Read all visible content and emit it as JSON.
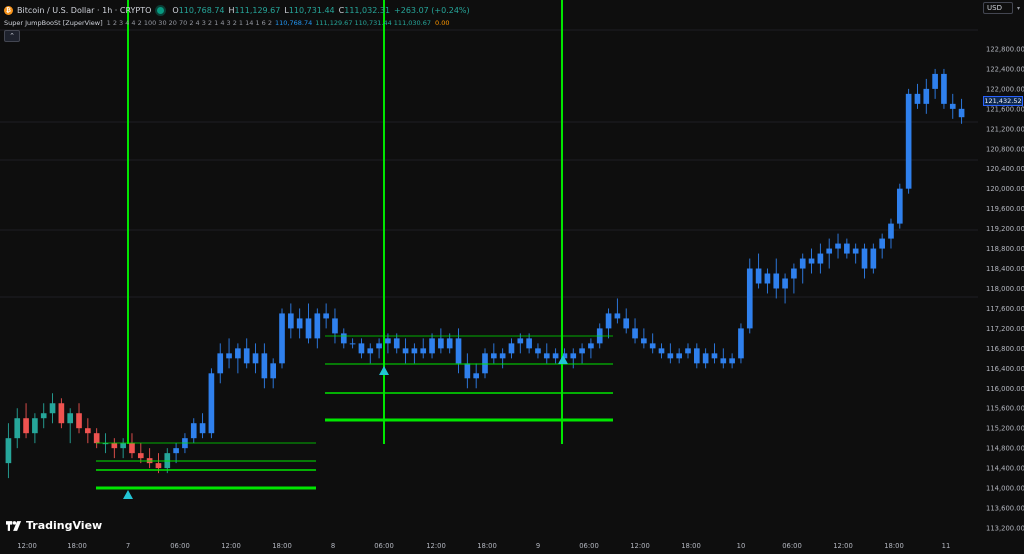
{
  "header": {
    "symbol": "Bitcoin / U.S. Dollar · 1h · CRYPTO",
    "coin_glyph": "₿",
    "ohlc": [
      {
        "label": "O",
        "value": "110,768.74"
      },
      {
        "label": "H",
        "value": "111,129.67"
      },
      {
        "label": "L",
        "value": "110,731.44"
      },
      {
        "label": "C",
        "value": "111,032.31"
      },
      {
        "label": "",
        "value": "+263.07 (+0.24%)"
      }
    ]
  },
  "indicator": {
    "name": "Super JumpBooSt [ZuperView]",
    "params": "1 2 3 4 4 2 100 30 20 70 2 4 3 2 1 4 3 2 1 14 1 6 2",
    "v1": "110,768.74",
    "v2": "111,129.67 110,731.44 111,030.67",
    "v3": "0.00"
  },
  "currency": "USD",
  "current_price": "121,432.52",
  "branding": "TradingView",
  "icons": {
    "collapse": "chevron-up-icon",
    "logo": "tradingview-logo-icon",
    "currency_dropdown": "chevron-down-icon"
  },
  "colors": {
    "background": "#0e0e0e",
    "bull_early": "#26a69a",
    "bear_early": "#ef5350",
    "candle": "#2f80ed",
    "signal": "#00e600",
    "marker": "#22c4d4"
  },
  "chart_data": {
    "type": "candlestick",
    "ylim": [
      113200,
      123200
    ],
    "y_ticks": [
      "122,800.00",
      "122,400.00",
      "122,000.00",
      "121,600.00",
      "121,200.00",
      "120,800.00",
      "120,400.00",
      "120,000.00",
      "119,600.00",
      "119,200.00",
      "118,800.00",
      "118,400.00",
      "118,000.00",
      "117,600.00",
      "117,200.00",
      "116,800.00",
      "116,400.00",
      "116,000.00",
      "115,600.00",
      "115,200.00",
      "114,800.00",
      "114,400.00",
      "114,000.00",
      "113,600.00",
      "113,200.00"
    ],
    "x_ticks": [
      "12:00",
      "18:00",
      "7",
      "06:00",
      "12:00",
      "18:00",
      "8",
      "06:00",
      "12:00",
      "18:00",
      "9",
      "06:00",
      "12:00",
      "18:00",
      "10",
      "06:00",
      "12:00",
      "18:00",
      "11"
    ],
    "candles": [
      [
        114500,
        115300,
        114200,
        115000
      ],
      [
        115000,
        115600,
        114800,
        115400
      ],
      [
        115400,
        115700,
        115000,
        115100
      ],
      [
        115100,
        115500,
        114900,
        115400
      ],
      [
        115400,
        115700,
        115200,
        115500
      ],
      [
        115500,
        115900,
        115300,
        115700
      ],
      [
        115700,
        115800,
        115200,
        115300
      ],
      [
        115300,
        115600,
        114900,
        115500
      ],
      [
        115500,
        115700,
        115100,
        115200
      ],
      [
        115200,
        115400,
        114900,
        115100
      ],
      [
        115100,
        115200,
        114800,
        114900
      ],
      [
        114900,
        115100,
        114700,
        114900
      ],
      [
        114900,
        115000,
        114600,
        114800
      ],
      [
        114800,
        115000,
        114600,
        114900
      ],
      [
        114900,
        115100,
        114600,
        114700
      ],
      [
        114700,
        114900,
        114500,
        114600
      ],
      [
        114600,
        114800,
        114400,
        114500
      ],
      [
        114500,
        114700,
        114300,
        114400
      ],
      [
        114400,
        114800,
        114300,
        114700
      ],
      [
        114700,
        114900,
        114500,
        114800
      ],
      [
        114800,
        115100,
        114700,
        115000
      ],
      [
        115000,
        115400,
        114900,
        115300
      ],
      [
        115300,
        115500,
        115000,
        115100
      ],
      [
        115100,
        116400,
        115000,
        116300
      ],
      [
        116300,
        116900,
        116100,
        116700
      ],
      [
        116700,
        117000,
        116400,
        116600
      ],
      [
        116600,
        116900,
        116300,
        116800
      ],
      [
        116800,
        117000,
        116400,
        116500
      ],
      [
        116500,
        116900,
        116300,
        116700
      ],
      [
        116700,
        116900,
        116000,
        116200
      ],
      [
        116200,
        116600,
        116000,
        116500
      ],
      [
        116500,
        117600,
        116400,
        117500
      ],
      [
        117500,
        117700,
        117000,
        117200
      ],
      [
        117200,
        117600,
        117000,
        117400
      ],
      [
        117400,
        117700,
        116900,
        117000
      ],
      [
        117000,
        117600,
        116800,
        117500
      ],
      [
        117500,
        117700,
        117200,
        117400
      ],
      [
        117400,
        117600,
        116900,
        117100
      ],
      [
        117100,
        117200,
        116800,
        116900
      ],
      [
        116900,
        117000,
        116800,
        116900
      ],
      [
        116900,
        117000,
        116600,
        116700
      ],
      [
        116700,
        116900,
        116500,
        116800
      ],
      [
        116800,
        117000,
        116600,
        116900
      ],
      [
        116900,
        117100,
        116700,
        117000
      ],
      [
        117000,
        117100,
        116700,
        116800
      ],
      [
        116800,
        117000,
        116500,
        116700
      ],
      [
        116700,
        116900,
        116500,
        116800
      ],
      [
        116800,
        117000,
        116600,
        116700
      ],
      [
        116700,
        117100,
        116600,
        117000
      ],
      [
        117000,
        117200,
        116700,
        116800
      ],
      [
        116800,
        117100,
        116700,
        117000
      ],
      [
        117000,
        117200,
        116300,
        116500
      ],
      [
        116500,
        116700,
        116000,
        116200
      ],
      [
        116200,
        116500,
        116000,
        116300
      ],
      [
        116300,
        116800,
        116200,
        116700
      ],
      [
        116700,
        116900,
        116500,
        116600
      ],
      [
        116600,
        116800,
        116400,
        116700
      ],
      [
        116700,
        117000,
        116600,
        116900
      ],
      [
        116900,
        117100,
        116700,
        117000
      ],
      [
        117000,
        117100,
        116700,
        116800
      ],
      [
        116800,
        116900,
        116600,
        116700
      ],
      [
        116700,
        116900,
        116500,
        116600
      ],
      [
        116600,
        116800,
        116500,
        116700
      ],
      [
        116700,
        116800,
        116500,
        116600
      ],
      [
        116600,
        116800,
        116400,
        116700
      ],
      [
        116700,
        116900,
        116500,
        116800
      ],
      [
        116800,
        117000,
        116600,
        116900
      ],
      [
        116900,
        117300,
        116800,
        117200
      ],
      [
        117200,
        117600,
        117000,
        117500
      ],
      [
        117500,
        117800,
        117300,
        117400
      ],
      [
        117400,
        117600,
        117100,
        117200
      ],
      [
        117200,
        117400,
        116900,
        117000
      ],
      [
        117000,
        117200,
        116800,
        116900
      ],
      [
        116900,
        117100,
        116700,
        116800
      ],
      [
        116800,
        116900,
        116600,
        116700
      ],
      [
        116700,
        116900,
        116500,
        116600
      ],
      [
        116600,
        116800,
        116500,
        116700
      ],
      [
        116700,
        116900,
        116600,
        116800
      ],
      [
        116800,
        116900,
        116400,
        116500
      ],
      [
        116500,
        116800,
        116400,
        116700
      ],
      [
        116700,
        116900,
        116500,
        116600
      ],
      [
        116600,
        116800,
        116400,
        116500
      ],
      [
        116500,
        116700,
        116400,
        116600
      ],
      [
        116600,
        117300,
        116500,
        117200
      ],
      [
        117200,
        118600,
        117100,
        118400
      ],
      [
        118400,
        118700,
        118000,
        118100
      ],
      [
        118100,
        118400,
        117900,
        118300
      ],
      [
        118300,
        118600,
        117800,
        118000
      ],
      [
        118000,
        118300,
        117700,
        118200
      ],
      [
        118200,
        118500,
        117900,
        118400
      ],
      [
        118400,
        118700,
        118100,
        118600
      ],
      [
        118600,
        118800,
        118300,
        118500
      ],
      [
        118500,
        118900,
        118300,
        118700
      ],
      [
        118700,
        119000,
        118400,
        118800
      ],
      [
        118800,
        119100,
        118600,
        118900
      ],
      [
        118900,
        119000,
        118600,
        118700
      ],
      [
        118700,
        118900,
        118500,
        118800
      ],
      [
        118800,
        118900,
        118200,
        118400
      ],
      [
        118400,
        118900,
        118300,
        118800
      ],
      [
        118800,
        119100,
        118600,
        119000
      ],
      [
        119000,
        119400,
        118800,
        119300
      ],
      [
        119300,
        120100,
        119200,
        120000
      ],
      [
        120000,
        122000,
        119900,
        121900
      ],
      [
        121900,
        122100,
        121600,
        121700
      ],
      [
        121700,
        122200,
        121500,
        122000
      ],
      [
        122000,
        122400,
        121800,
        122300
      ],
      [
        122300,
        122400,
        121600,
        121700
      ],
      [
        121700,
        121900,
        121400,
        121600
      ],
      [
        121600,
        121800,
        121300,
        121432.52
      ]
    ]
  }
}
